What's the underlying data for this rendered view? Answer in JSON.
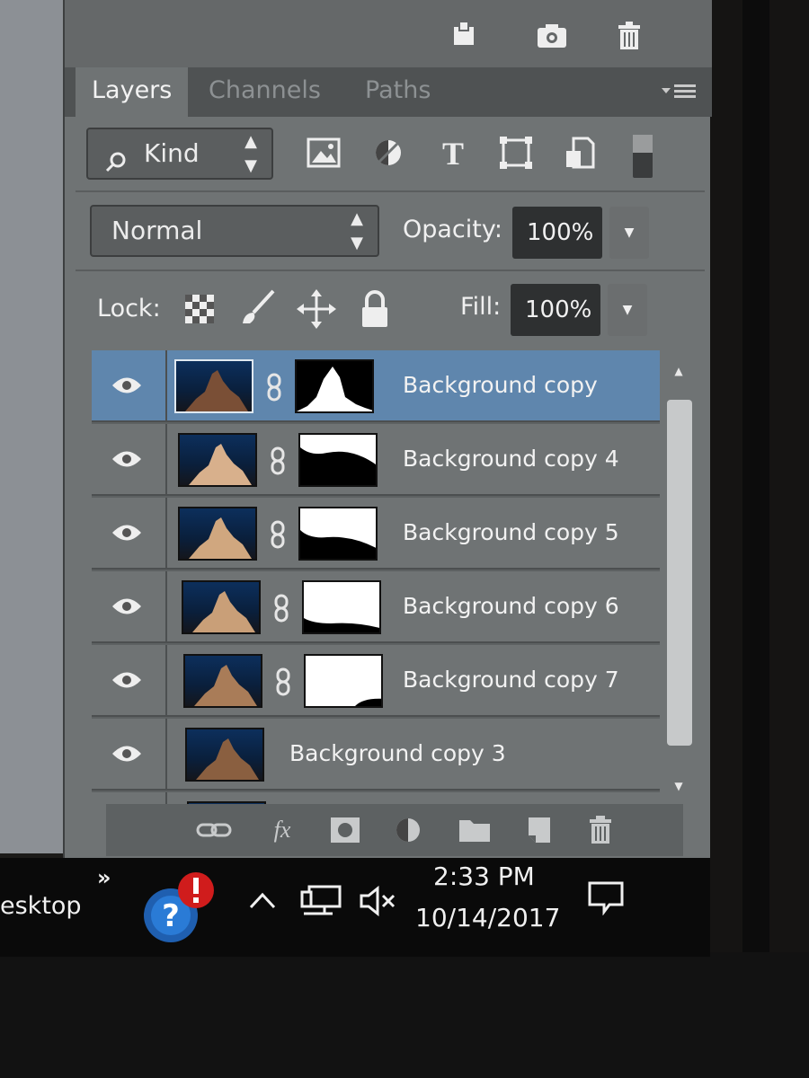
{
  "toolbar_top": {
    "icons": [
      "new-layer-group-icon",
      "camera-icon",
      "trash-icon"
    ]
  },
  "tabs": {
    "layers": "Layers",
    "channels": "Channels",
    "paths": "Paths"
  },
  "filter": {
    "kind_label": "Kind",
    "icons": [
      "image-filter-icon",
      "adjustment-filter-icon",
      "type-filter-icon",
      "shape-filter-icon",
      "smart-object-filter-icon",
      "filter-toggle-icon"
    ]
  },
  "blend": {
    "mode": "Normal",
    "opacity_label": "Opacity:",
    "opacity_value": "100%"
  },
  "lock": {
    "label": "Lock:",
    "icons": [
      "lock-transparent-icon",
      "lock-paint-icon",
      "lock-position-icon",
      "lock-all-icon"
    ],
    "fill_label": "Fill:",
    "fill_value": "100%"
  },
  "layers": [
    {
      "name": "Background copy",
      "selected": true,
      "has_mask": true
    },
    {
      "name": "Background copy 4",
      "selected": false,
      "has_mask": true
    },
    {
      "name": "Background copy 5",
      "selected": false,
      "has_mask": true
    },
    {
      "name": "Background copy 6",
      "selected": false,
      "has_mask": true
    },
    {
      "name": "Background copy 7",
      "selected": false,
      "has_mask": true
    },
    {
      "name": "Background copy 3",
      "selected": false,
      "has_mask": false
    }
  ],
  "bottom_icons": [
    "link-layers-icon",
    "fx-icon",
    "add-mask-icon",
    "adjustment-layer-icon",
    "group-folder-icon",
    "new-layer-icon",
    "delete-layer-icon"
  ],
  "taskbar": {
    "desktop_label": "esktop",
    "overflow": "»",
    "time": "2:33 PM",
    "date": "10/14/2017"
  },
  "colors": {
    "panel": "#6f7374",
    "selected_row": "#5f86ad",
    "taskbar": "#0a0a0a"
  }
}
